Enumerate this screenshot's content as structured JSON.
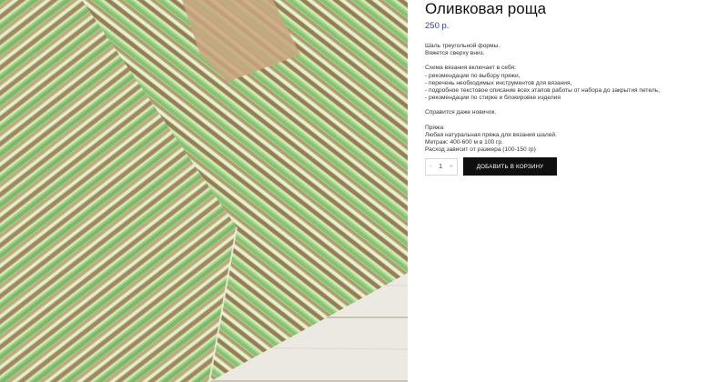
{
  "product": {
    "title": "Оливковая роща",
    "price": "250 р.",
    "image_alt": "green and brown knitted triangular shawl on white wooden boards"
  },
  "description": {
    "intro": [
      "Шаль треугольной формы.",
      "Вяжется сверху вниз."
    ],
    "scheme_title": "Схема вязания включает в себя:",
    "scheme_items": [
      "- рекомендации по выбору пряжи,",
      "- перечень необходимых инструментов для вязания,",
      "- подробное текстовое описание всех этапов работы от набора до закрытия петель,",
      "- рекомендации по стирке и блокировке изделия"
    ],
    "level": "Справится даже новичок.",
    "yarn_title": "Пряжа:",
    "yarn_items": [
      "Любая натуральная пряжа для вязания шалей.",
      "Метраж: 400-600 м в 100 гр.",
      "Расход зависит от размера (100-150 гр)"
    ]
  },
  "purchase": {
    "minus": "-",
    "quantity": "1",
    "plus": "+",
    "add_to_cart": "ДОБАВИТЬ В КОРЗИНУ"
  },
  "colors": {
    "price": "#2e3fbf",
    "button_bg": "#0f0f0f"
  }
}
